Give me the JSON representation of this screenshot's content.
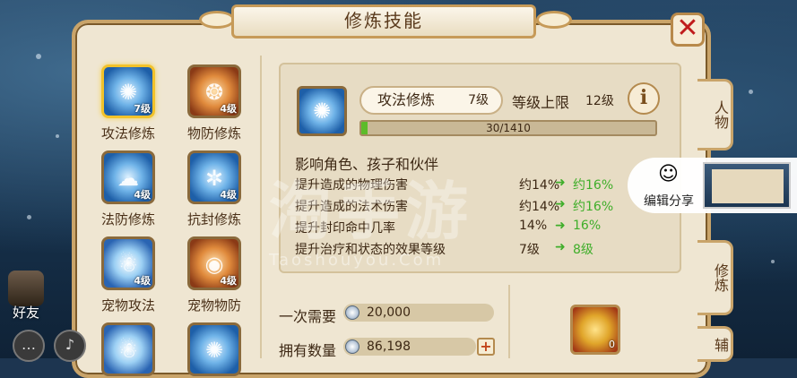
{
  "window": {
    "title": "修炼技能",
    "close_icon": "close-icon"
  },
  "skills": [
    {
      "name": "攻法修炼",
      "level": "7级",
      "selected": true,
      "style": "blue"
    },
    {
      "name": "物防修炼",
      "level": "4级",
      "selected": false,
      "style": "fire"
    },
    {
      "name": "法防修炼",
      "level": "4级",
      "selected": false,
      "style": "blue"
    },
    {
      "name": "抗封修炼",
      "level": "4级",
      "selected": false,
      "style": "blue"
    },
    {
      "name": "宠物攻法",
      "level": "4级",
      "selected": false,
      "style": "ghost"
    },
    {
      "name": "宠物物防",
      "level": "4级",
      "selected": false,
      "style": "fire"
    },
    {
      "name": "",
      "level": "",
      "selected": false,
      "style": "ghost"
    },
    {
      "name": "",
      "level": "",
      "selected": false,
      "style": "blue"
    }
  ],
  "detail": {
    "name": "攻法修炼",
    "level": "7级",
    "cap_label": "等级上限",
    "cap_value": "12级",
    "info_label": "i",
    "progress_text": "30/1410",
    "progress_fraction": 0.021,
    "effect_title": "影响角色、孩子和伙伴",
    "effects": [
      {
        "text": "提升造成的物理伤害",
        "current": "约14%",
        "next": "约16%"
      },
      {
        "text": "提升造成的法术伤害",
        "current": "约14%",
        "next": "约16%"
      },
      {
        "text": "提升封印命中几率",
        "current": "14%",
        "next": "16%"
      },
      {
        "text": "提升治疗和状态的效果等级",
        "current": "7级",
        "next": "8级"
      }
    ]
  },
  "watermark": {
    "main": "淘手游",
    "sub": "Taoshouyou.Com"
  },
  "cost": {
    "need_label": "一次需要",
    "need_value": "20,000",
    "own_label": "拥有数量",
    "own_value": "86,198",
    "plus_label": "+",
    "chest_count": "0"
  },
  "side_tabs": [
    "人物",
    "修炼",
    "辅"
  ],
  "share": {
    "label": "编辑分享"
  },
  "bottom": {
    "friend_label": "好友",
    "chat_icon": "chat-icon",
    "voice_icon": "voice-icon"
  },
  "colors": {
    "accent": "#c9a46a",
    "progress": "#5dbb2a",
    "upgrade": "#3fae2a",
    "close": "#c01c1c"
  }
}
